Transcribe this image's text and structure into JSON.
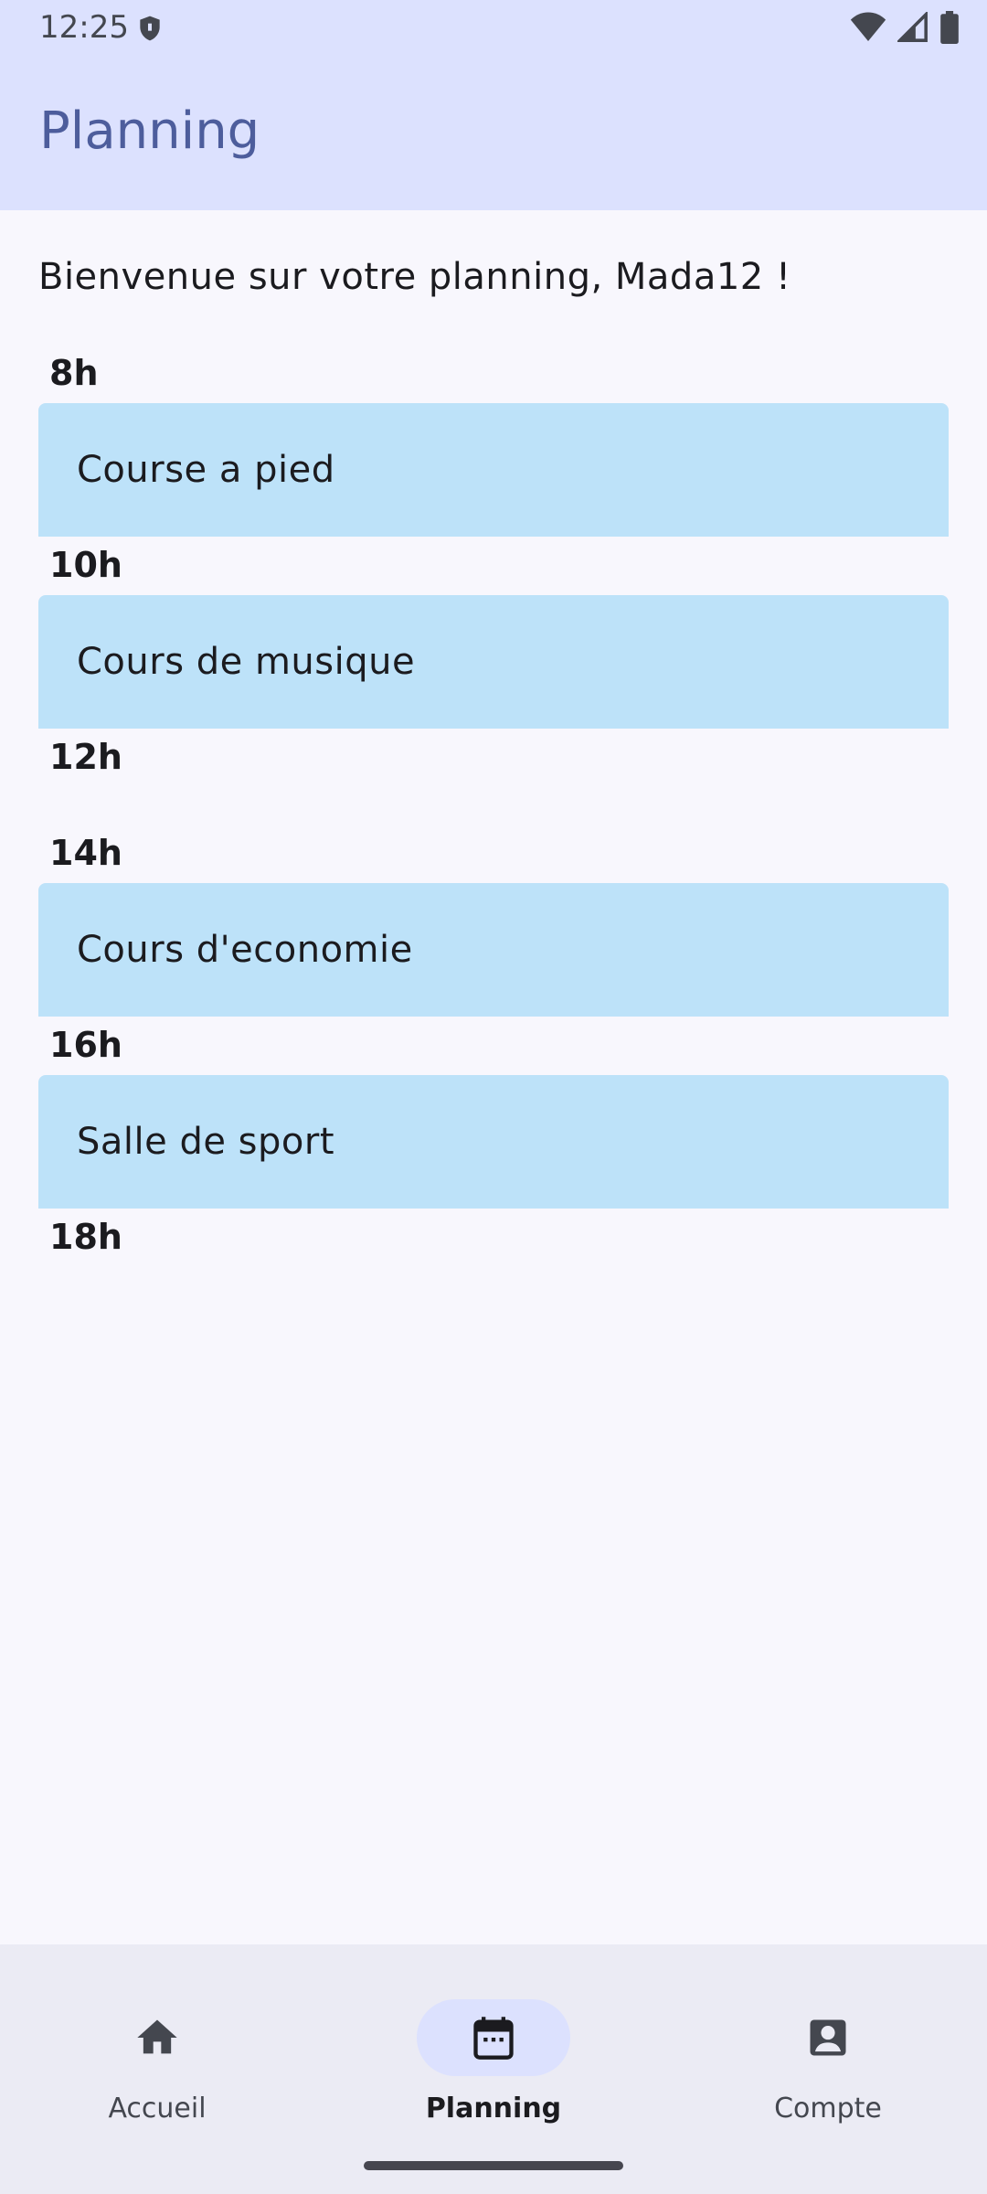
{
  "status_bar": {
    "time": "12:25",
    "icons": [
      "shield-icon",
      "wifi-icon",
      "signal-icon",
      "battery-icon"
    ]
  },
  "app_bar": {
    "title": "Planning"
  },
  "main": {
    "welcome": "Bienvenue sur votre planning, Mada12 !",
    "schedule": [
      {
        "hour": "8h",
        "event": "Course a pied"
      },
      {
        "hour": "10h",
        "event": "Cours de musique"
      },
      {
        "hour": "12h",
        "event": null
      },
      {
        "hour": "14h",
        "event": "Cours d'economie"
      },
      {
        "hour": "16h",
        "event": "Salle de sport"
      },
      {
        "hour": "18h",
        "event": null
      }
    ]
  },
  "bottom_nav": {
    "items": [
      {
        "label": "Accueil",
        "icon": "home-icon",
        "active": false
      },
      {
        "label": "Planning",
        "icon": "calendar-icon",
        "active": true
      },
      {
        "label": "Compte",
        "icon": "account-box-icon",
        "active": false
      }
    ]
  },
  "colors": {
    "app_bar_bg": "#dce1fe",
    "title": "#4d5d9c",
    "event_card": "#bde2f9",
    "background": "#f8f7fd",
    "nav_bg": "#ebebf4",
    "nav_active_pill": "#dce1fe"
  }
}
